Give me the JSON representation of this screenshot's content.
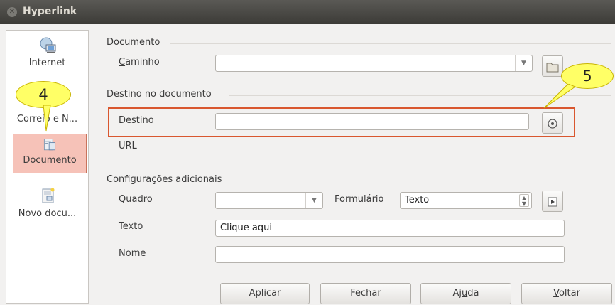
{
  "window": {
    "title": "Hyperlink"
  },
  "sidebar": {
    "items": [
      {
        "label": "Internet"
      },
      {
        "label": "Correio e N..."
      },
      {
        "label": "Documento"
      },
      {
        "label": "Novo docu..."
      }
    ]
  },
  "document_section": {
    "title": "Documento",
    "path_label_prefix": "C",
    "path_label_rest": "aminho",
    "path_value": ""
  },
  "target_section": {
    "title": "Destino no documento",
    "target_label_prefix": "D",
    "target_label_rest": "estino",
    "target_value": "",
    "url_label": "URL"
  },
  "additional_section": {
    "title": "Configurações adicionais",
    "frame_label_a": "Quad",
    "frame_label_u": "r",
    "frame_label_b": "o",
    "frame_value": "",
    "form_label_a": "F",
    "form_label_u": "o",
    "form_label_b": "rmulário",
    "form_value": "Texto",
    "text_label_a": "Te",
    "text_label_u": "x",
    "text_label_b": "to",
    "text_value": "Clique aqui",
    "name_label_a": "N",
    "name_label_u": "o",
    "name_label_b": "me",
    "name_value": ""
  },
  "buttons": {
    "apply": "Aplicar",
    "close": "Fechar",
    "help_a": "Aj",
    "help_u": "u",
    "help_b": "da",
    "back_u": "V",
    "back_b": "oltar"
  },
  "annotations": {
    "callout_4": "4",
    "callout_5": "5",
    "callout_color": "#ffff66",
    "highlight_color": "#d9572f"
  },
  "icons": [
    "close-icon",
    "globe-computer-icon",
    "document-target-icon",
    "new-document-icon",
    "folder-icon",
    "target-icon",
    "events-icon"
  ]
}
